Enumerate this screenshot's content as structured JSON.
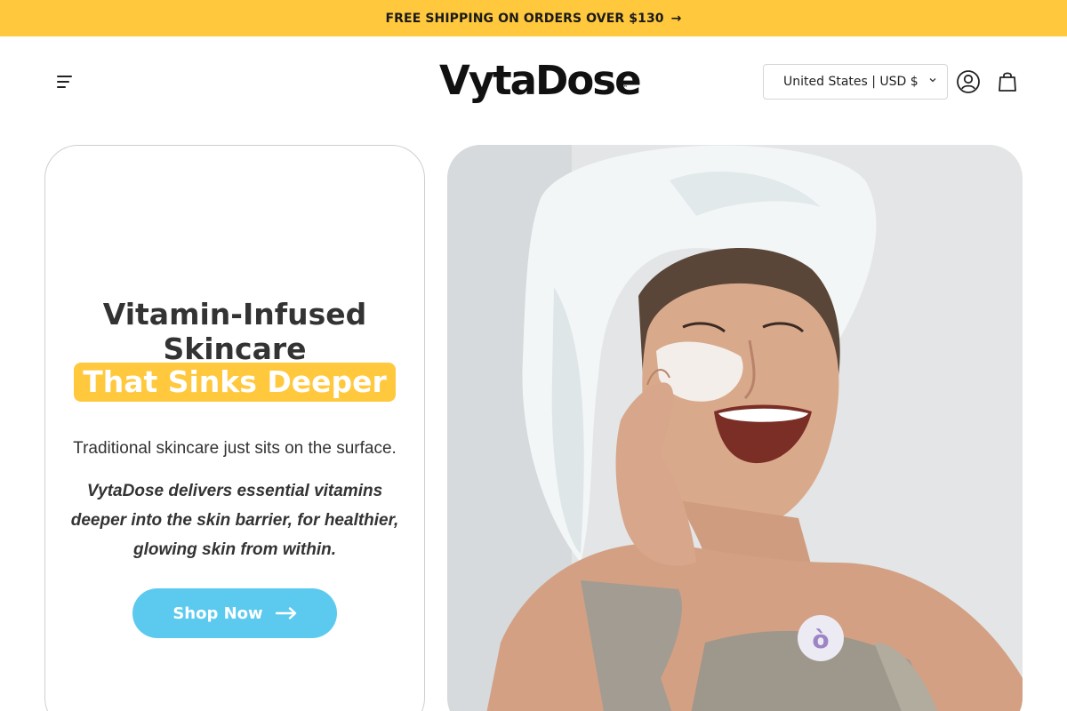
{
  "announcement": {
    "text": "FREE SHIPPING ON ORDERS OVER $130",
    "arrow": "→"
  },
  "header": {
    "menu_icon": "menu-icon",
    "logo": {
      "text": "VytaDose",
      "tm": "™"
    },
    "region_selector": {
      "value": "United States | USD $",
      "icon": "chevron-down-icon"
    },
    "account_icon": "account-icon",
    "cart_icon": "shopping-bag-icon"
  },
  "hero": {
    "title_line1": "Vitamin-Infused",
    "title_line2": "Skincare",
    "title_highlight": "That Sinks Deeper",
    "subtext": "Traditional skincare just sits on the surface.",
    "emphasis": "VytaDose delivers essential vitamins deeper into the skin barrier, for healthier, glowing skin from within.",
    "cta_label": "Shop Now",
    "cta_icon": "arrow-right-icon",
    "image": "woman-with-towel-applying-face-cream",
    "patch_logo": "ò"
  },
  "colors": {
    "accent_yellow": "#ffc83d",
    "button_blue": "#5ccaee",
    "text_dark": "#333333"
  }
}
